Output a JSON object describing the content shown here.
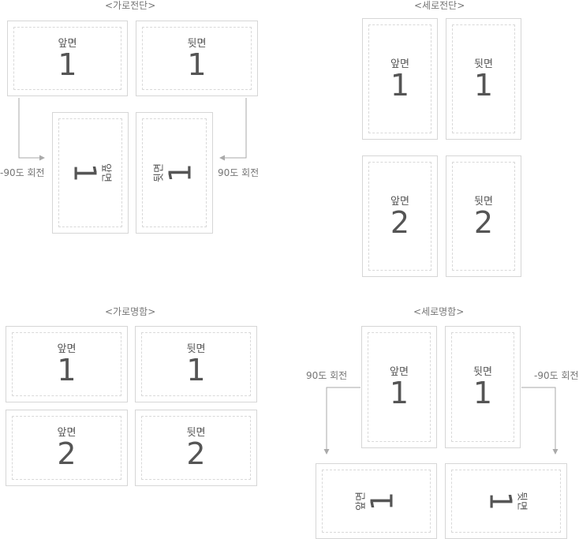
{
  "titles": {
    "landscape_cut": "<가로전단>",
    "portrait_cut": "<세로전단>",
    "landscape_combined": "<가로명함>",
    "portrait_combined": "<세로명함>"
  },
  "labels": {
    "front": "앞면",
    "back": "뒷면"
  },
  "numbers": {
    "one": "1",
    "two": "2"
  },
  "notes": {
    "minus90": "-90도 회전",
    "plus90": "90도 회전"
  },
  "colors": {
    "border": "#d6d6d6",
    "dashed": "#d9d9d9",
    "arrow": "#aaaaaa",
    "text": "#555555"
  }
}
